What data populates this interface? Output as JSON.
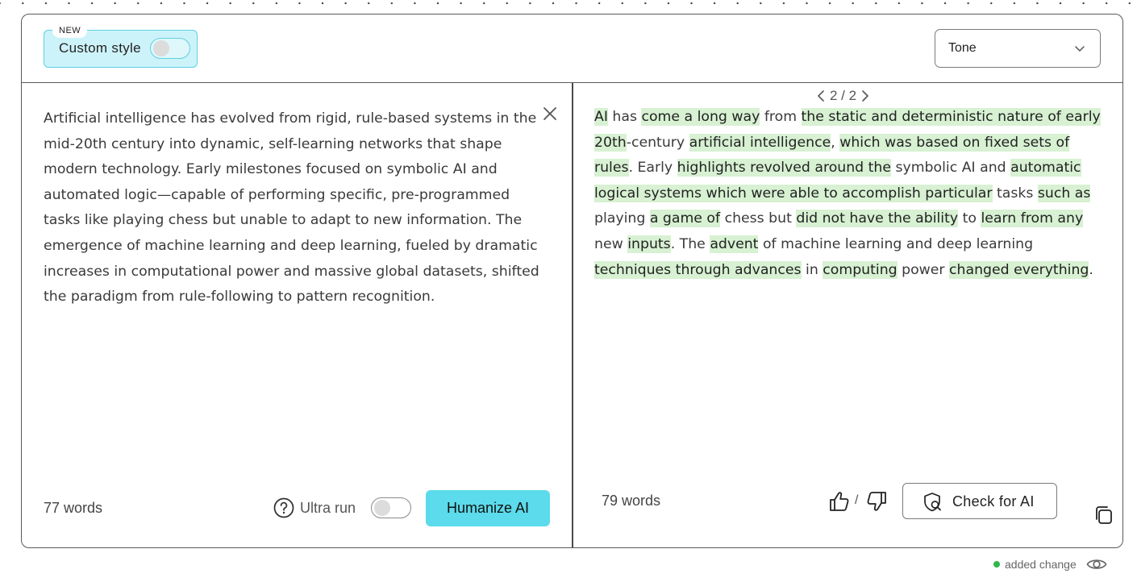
{
  "header": {
    "new_badge": "NEW",
    "custom_style_label": "Custom style",
    "tone_label": "Tone"
  },
  "input": {
    "text": "Artificial intelligence has evolved from rigid, rule-based systems in the mid-20th century into dynamic, self-learning networks that shape modern technology. Early milestones focused on symbolic AI and automated logic—capable of performing specific, pre-programmed tasks like playing chess but unable to adapt to new information. The emergence of machine learning and deep learning, fueled by dramatic increases in computational power and massive global datasets, shifted the paradigm from rule-following to pattern recognition.",
    "word_count": "77 words",
    "ultra_run_label": "Ultra run",
    "humanize_label": "Humanize AI"
  },
  "output": {
    "pager": "2 / 2",
    "segments": [
      {
        "t": "AI",
        "hl": true
      },
      {
        "t": " has ",
        "hl": false
      },
      {
        "t": "come a long way",
        "hl": true
      },
      {
        "t": " from ",
        "hl": false
      },
      {
        "t": "the static and deterministic nature of early 20th",
        "hl": true
      },
      {
        "t": "-century ",
        "hl": false
      },
      {
        "t": "artificial intelligence",
        "hl": true
      },
      {
        "t": ", ",
        "hl": false
      },
      {
        "t": "which was based on fixed sets of rules",
        "hl": true
      },
      {
        "t": ". Early ",
        "hl": false
      },
      {
        "t": "highlights revolved around the",
        "hl": true
      },
      {
        "t": " symbolic AI and ",
        "hl": false
      },
      {
        "t": "automatic logical systems which were able to accomplish particular",
        "hl": true
      },
      {
        "t": " tasks ",
        "hl": false
      },
      {
        "t": "such as",
        "hl": true
      },
      {
        "t": " playing ",
        "hl": false
      },
      {
        "t": "a game of",
        "hl": true
      },
      {
        "t": " chess but ",
        "hl": false
      },
      {
        "t": "did not have the ability",
        "hl": true
      },
      {
        "t": " to ",
        "hl": false
      },
      {
        "t": "learn from any",
        "hl": true
      },
      {
        "t": " new ",
        "hl": false
      },
      {
        "t": "inputs",
        "hl": true
      },
      {
        "t": ". The ",
        "hl": false
      },
      {
        "t": "advent",
        "hl": true
      },
      {
        "t": " of machine learning and deep learning ",
        "hl": false
      },
      {
        "t": "techniques through advances",
        "hl": true
      },
      {
        "t": " in ",
        "hl": false
      },
      {
        "t": "computing",
        "hl": true
      },
      {
        "t": " power ",
        "hl": false
      },
      {
        "t": "changed everything",
        "hl": true
      },
      {
        "t": ".",
        "hl": false
      }
    ],
    "word_count": "79 words",
    "slash": "/",
    "check_label": "Check for AI"
  },
  "legend": {
    "label": "added change",
    "color": "#2fb84a"
  },
  "colors": {
    "highlight": "#d7f1d2",
    "accent": "#5bdbeb",
    "custom_style_bg": "#cdf3fa"
  }
}
